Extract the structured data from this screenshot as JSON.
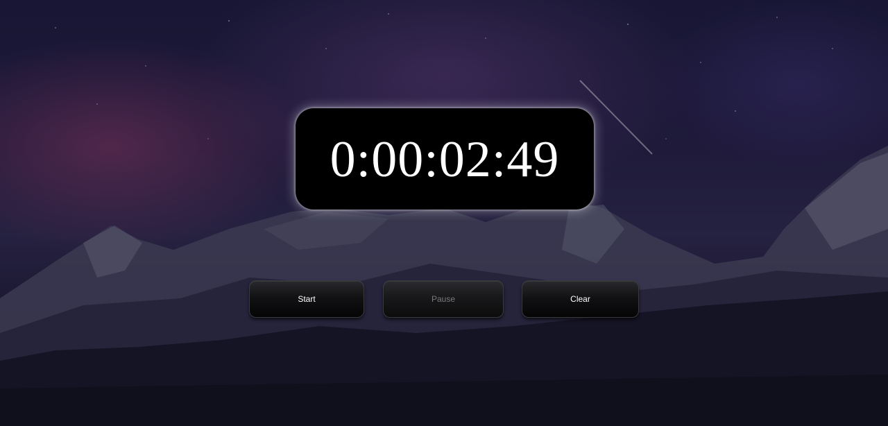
{
  "timer": {
    "display": "0:00:02:49"
  },
  "controls": {
    "start_label": "Start",
    "pause_label": "Pause",
    "clear_label": "Clear"
  },
  "colors": {
    "display_background": "#000000",
    "display_text": "#ffffff",
    "button_text": "#ffffff",
    "button_disabled_text": "#7a7a7e"
  }
}
